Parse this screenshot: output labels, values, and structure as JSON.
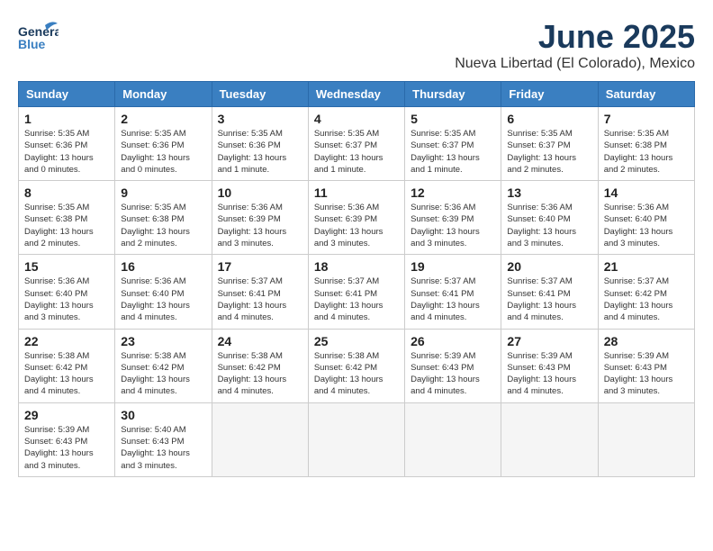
{
  "header": {
    "logo_general": "General",
    "logo_blue": "Blue",
    "month": "June 2025",
    "location": "Nueva Libertad (El Colorado), Mexico"
  },
  "weekdays": [
    "Sunday",
    "Monday",
    "Tuesday",
    "Wednesday",
    "Thursday",
    "Friday",
    "Saturday"
  ],
  "days": [
    {
      "date": 1,
      "sunrise": "5:35 AM",
      "sunset": "6:36 PM",
      "daylight": "13 hours and 0 minutes."
    },
    {
      "date": 2,
      "sunrise": "5:35 AM",
      "sunset": "6:36 PM",
      "daylight": "13 hours and 0 minutes."
    },
    {
      "date": 3,
      "sunrise": "5:35 AM",
      "sunset": "6:36 PM",
      "daylight": "13 hours and 1 minute."
    },
    {
      "date": 4,
      "sunrise": "5:35 AM",
      "sunset": "6:37 PM",
      "daylight": "13 hours and 1 minute."
    },
    {
      "date": 5,
      "sunrise": "5:35 AM",
      "sunset": "6:37 PM",
      "daylight": "13 hours and 1 minute."
    },
    {
      "date": 6,
      "sunrise": "5:35 AM",
      "sunset": "6:37 PM",
      "daylight": "13 hours and 2 minutes."
    },
    {
      "date": 7,
      "sunrise": "5:35 AM",
      "sunset": "6:38 PM",
      "daylight": "13 hours and 2 minutes."
    },
    {
      "date": 8,
      "sunrise": "5:35 AM",
      "sunset": "6:38 PM",
      "daylight": "13 hours and 2 minutes."
    },
    {
      "date": 9,
      "sunrise": "5:35 AM",
      "sunset": "6:38 PM",
      "daylight": "13 hours and 2 minutes."
    },
    {
      "date": 10,
      "sunrise": "5:36 AM",
      "sunset": "6:39 PM",
      "daylight": "13 hours and 3 minutes."
    },
    {
      "date": 11,
      "sunrise": "5:36 AM",
      "sunset": "6:39 PM",
      "daylight": "13 hours and 3 minutes."
    },
    {
      "date": 12,
      "sunrise": "5:36 AM",
      "sunset": "6:39 PM",
      "daylight": "13 hours and 3 minutes."
    },
    {
      "date": 13,
      "sunrise": "5:36 AM",
      "sunset": "6:40 PM",
      "daylight": "13 hours and 3 minutes."
    },
    {
      "date": 14,
      "sunrise": "5:36 AM",
      "sunset": "6:40 PM",
      "daylight": "13 hours and 3 minutes."
    },
    {
      "date": 15,
      "sunrise": "5:36 AM",
      "sunset": "6:40 PM",
      "daylight": "13 hours and 3 minutes."
    },
    {
      "date": 16,
      "sunrise": "5:36 AM",
      "sunset": "6:40 PM",
      "daylight": "13 hours and 4 minutes."
    },
    {
      "date": 17,
      "sunrise": "5:37 AM",
      "sunset": "6:41 PM",
      "daylight": "13 hours and 4 minutes."
    },
    {
      "date": 18,
      "sunrise": "5:37 AM",
      "sunset": "6:41 PM",
      "daylight": "13 hours and 4 minutes."
    },
    {
      "date": 19,
      "sunrise": "5:37 AM",
      "sunset": "6:41 PM",
      "daylight": "13 hours and 4 minutes."
    },
    {
      "date": 20,
      "sunrise": "5:37 AM",
      "sunset": "6:41 PM",
      "daylight": "13 hours and 4 minutes."
    },
    {
      "date": 21,
      "sunrise": "5:37 AM",
      "sunset": "6:42 PM",
      "daylight": "13 hours and 4 minutes."
    },
    {
      "date": 22,
      "sunrise": "5:38 AM",
      "sunset": "6:42 PM",
      "daylight": "13 hours and 4 minutes."
    },
    {
      "date": 23,
      "sunrise": "5:38 AM",
      "sunset": "6:42 PM",
      "daylight": "13 hours and 4 minutes."
    },
    {
      "date": 24,
      "sunrise": "5:38 AM",
      "sunset": "6:42 PM",
      "daylight": "13 hours and 4 minutes."
    },
    {
      "date": 25,
      "sunrise": "5:38 AM",
      "sunset": "6:42 PM",
      "daylight": "13 hours and 4 minutes."
    },
    {
      "date": 26,
      "sunrise": "5:39 AM",
      "sunset": "6:43 PM",
      "daylight": "13 hours and 4 minutes."
    },
    {
      "date": 27,
      "sunrise": "5:39 AM",
      "sunset": "6:43 PM",
      "daylight": "13 hours and 4 minutes."
    },
    {
      "date": 28,
      "sunrise": "5:39 AM",
      "sunset": "6:43 PM",
      "daylight": "13 hours and 3 minutes."
    },
    {
      "date": 29,
      "sunrise": "5:39 AM",
      "sunset": "6:43 PM",
      "daylight": "13 hours and 3 minutes."
    },
    {
      "date": 30,
      "sunrise": "5:40 AM",
      "sunset": "6:43 PM",
      "daylight": "13 hours and 3 minutes."
    }
  ],
  "labels": {
    "sunrise": "Sunrise:",
    "sunset": "Sunset:",
    "daylight": "Daylight:"
  }
}
